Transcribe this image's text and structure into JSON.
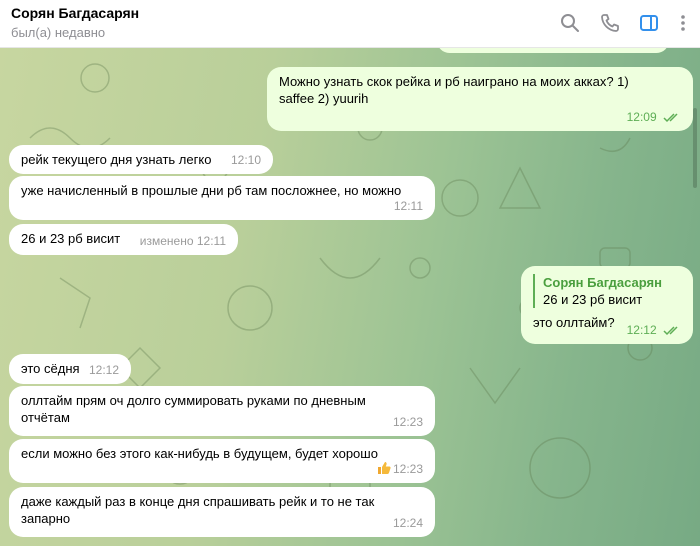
{
  "header": {
    "title": "Сорян Багдасарян",
    "status": "был(а) недавно",
    "icons": [
      "search-icon",
      "phone-icon",
      "sidebar-panel-icon",
      "more-icon"
    ],
    "accent": "#3390ec"
  },
  "colors": {
    "incoming_bubble": "#ffffff",
    "outgoing_bubble": "#eeffde",
    "outgoing_time": "#5eae55",
    "incoming_time": "#9a9a9a"
  },
  "messages": [
    {
      "id": "m1",
      "direction": "out",
      "text": "Можно узнать скок рейка и рб наиграно на моих акках? 1) saffee 2) yuurih",
      "time": "12:09",
      "read": true
    },
    {
      "id": "m2",
      "direction": "in",
      "text": "рейк текущего дня узнать легко",
      "time": "12:10"
    },
    {
      "id": "m3",
      "direction": "in",
      "text": "уже начисленный в прошлые дни рб там посложнее, но можно",
      "time": "12:11"
    },
    {
      "id": "m4",
      "direction": "in",
      "text": "26 и 23 рб висит",
      "edited": "изменено",
      "time": "12:11"
    },
    {
      "id": "m5",
      "direction": "out",
      "reply_name": "Сорян Багдасарян",
      "reply_text": "26 и 23 рб висит",
      "text": "это оллтайм?",
      "time": "12:12",
      "read": true
    },
    {
      "id": "m6",
      "direction": "in",
      "text": "это сёдня",
      "time": "12:12"
    },
    {
      "id": "m7",
      "direction": "in",
      "text": "оллтайм прям оч долго суммировать руками по дневным отчётам",
      "time": "12:23"
    },
    {
      "id": "m8",
      "direction": "in",
      "text": "если можно без этого как-нибудь в будущем, будет хорошо",
      "time": "12:23",
      "reaction": "thumbs-up"
    },
    {
      "id": "m9",
      "direction": "in",
      "text": "даже каждый раз в конце дня спрашивать рейк и то не так запарно",
      "time": "12:24"
    }
  ]
}
